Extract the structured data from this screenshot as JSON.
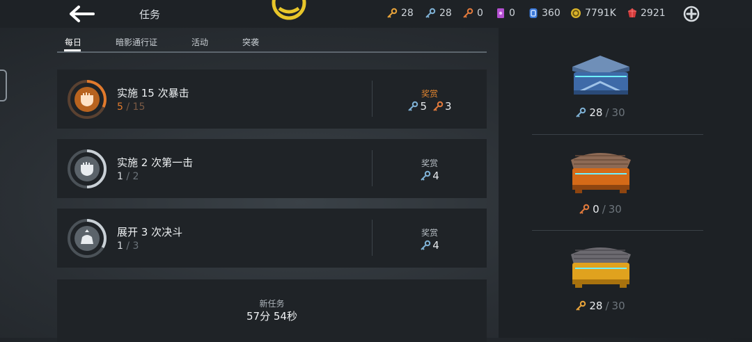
{
  "header": {
    "title": "任务",
    "resources": [
      {
        "name": "gold-key",
        "value": "28",
        "color": "#e8a33a"
      },
      {
        "name": "silver-key",
        "value": "28",
        "color": "#7fb2d6"
      },
      {
        "name": "bronze-key",
        "value": "0",
        "color": "#e27a3c"
      },
      {
        "name": "purple-ticket",
        "value": "0",
        "color": "#b44fd0"
      },
      {
        "name": "blue-token",
        "value": "360",
        "color": "#3a78d8"
      },
      {
        "name": "coin",
        "value": "7791K",
        "color": "#d9b42a"
      },
      {
        "name": "ruby",
        "value": "2921",
        "color": "#d33a3a"
      }
    ]
  },
  "tabs": [
    "每日",
    "暗影通行证",
    "活动",
    "突袭"
  ],
  "quests": [
    {
      "title": "实施 15 次暴击",
      "current": "5",
      "total": "15",
      "reward_label": "奖赏",
      "rewards": [
        {
          "icon": "silver-key",
          "amount": "5"
        },
        {
          "icon": "bronze-key",
          "amount": "3"
        }
      ]
    },
    {
      "title": "实施 2 次第一击",
      "current": "1",
      "total": "2",
      "reward_label": "奖赏",
      "rewards": [
        {
          "icon": "silver-key",
          "amount": "4"
        }
      ]
    },
    {
      "title": "展开 3 次决斗",
      "current": "1",
      "total": "3",
      "reward_label": "奖赏",
      "rewards": [
        {
          "icon": "silver-key",
          "amount": "4"
        }
      ]
    }
  ],
  "new_quest": {
    "label": "新任务",
    "time": "57分 54秒"
  },
  "chests": [
    {
      "key": "silver-key",
      "current": "28",
      "total": "30"
    },
    {
      "key": "bronze-key",
      "current": "0",
      "total": "30"
    },
    {
      "key": "gold-key",
      "current": "28",
      "total": "30"
    }
  ]
}
